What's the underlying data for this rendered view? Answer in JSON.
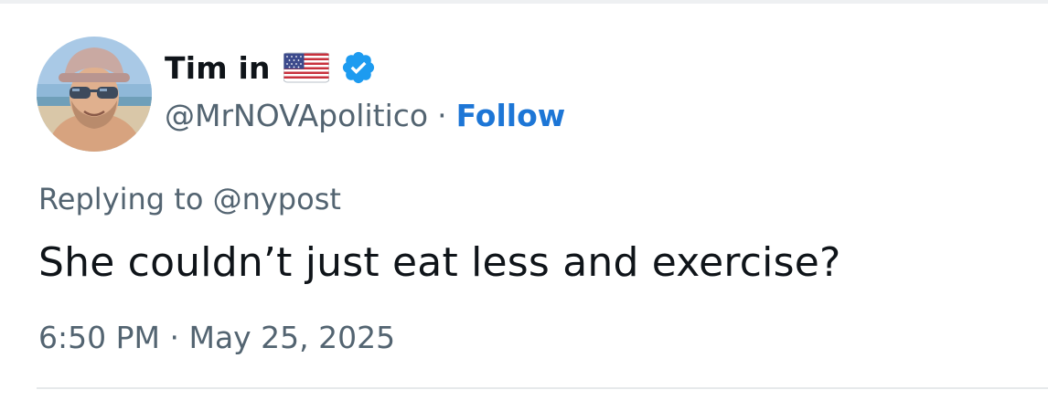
{
  "author": {
    "display_name": "Tim in",
    "flag_icon": "us-flag-icon",
    "verified_icon": "verified-badge-icon",
    "handle": "@MrNOVApolitico",
    "separator": "·",
    "follow_label": "Follow",
    "avatar_icon": "profile-photo"
  },
  "reply": {
    "prefix": "Replying to",
    "to_handle": "@nypost"
  },
  "tweet": {
    "text": "She couldn’t just eat less and exercise?",
    "time": "6:50 PM",
    "separator": "·",
    "date": "May 25, 2025"
  },
  "colors": {
    "text_primary": "#0f1419",
    "text_secondary": "#536471",
    "follow_blue": "#1d76d6",
    "verified_blue": "#1d9bf0"
  }
}
